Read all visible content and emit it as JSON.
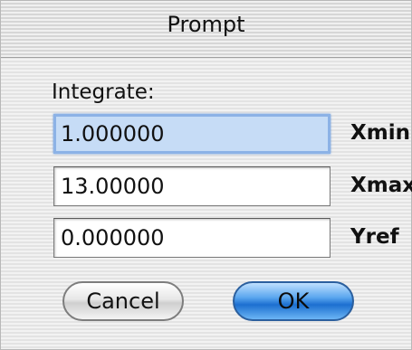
{
  "dialog": {
    "title": "Prompt",
    "prompt_label": "Integrate:"
  },
  "fields": [
    {
      "value": "1.000000",
      "label": "Xmin"
    },
    {
      "value": "13.00000",
      "label": "Xmax"
    },
    {
      "value": "0.000000",
      "label": "Yref"
    }
  ],
  "buttons": {
    "cancel_label": "Cancel",
    "ok_label": "OK"
  }
}
